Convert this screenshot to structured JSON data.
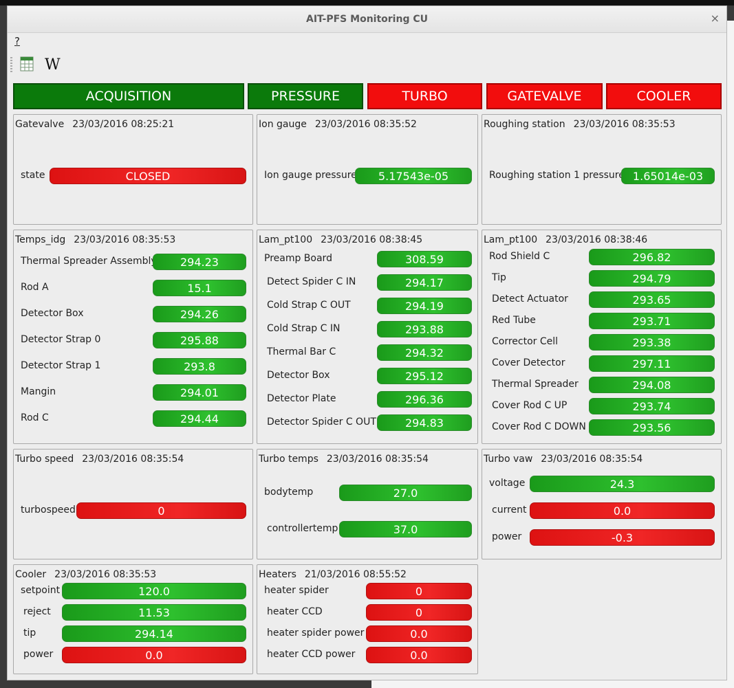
{
  "window": {
    "title": "AIT-PFS Monitoring CU",
    "close_glyph": "×"
  },
  "menu": {
    "help": "?"
  },
  "toolbar": {
    "sheet_icon": "spreadsheet-icon",
    "wiki_label": "W"
  },
  "status_buttons": [
    {
      "label": "ACQUISITION",
      "state": "green"
    },
    {
      "label": "PRESSURE",
      "state": "green"
    },
    {
      "label": "TURBO",
      "state": "red"
    },
    {
      "label": "GATEVALVE",
      "state": "red"
    },
    {
      "label": "COOLER",
      "state": "red"
    }
  ],
  "colors": {
    "ok": "#2ec02e",
    "alarm": "#f02626",
    "button_green": "#0b7a0b",
    "button_red": "#f20d0d"
  },
  "panels": {
    "gatevalve": {
      "name": "Gatevalve",
      "timestamp": "23/03/2016 08:25:21",
      "rows": [
        {
          "label": "state",
          "value": "CLOSED",
          "status": "r"
        }
      ]
    },
    "iongauge": {
      "name": "Ion gauge",
      "timestamp": "23/03/2016 08:35:52",
      "rows": [
        {
          "label": "Ion gauge pressure",
          "value": "5.17543e-05",
          "status": "g"
        }
      ]
    },
    "roughing": {
      "name": "Roughing station",
      "timestamp": "23/03/2016 08:35:53",
      "rows": [
        {
          "label": "Roughing station 1 pressure",
          "value": "1.65014e-03",
          "status": "g"
        }
      ]
    },
    "temps_idg": {
      "name": "Temps_idg",
      "timestamp": "23/03/2016 08:35:53",
      "rows": [
        {
          "label": "Thermal Spreader Assembly",
          "value": "294.23",
          "status": "g"
        },
        {
          "label": "Rod A",
          "value": "15.1",
          "status": "g"
        },
        {
          "label": "Detector Box",
          "value": "294.26",
          "status": "g"
        },
        {
          "label": "Detector Strap 0",
          "value": "295.88",
          "status": "g"
        },
        {
          "label": "Detector Strap 1",
          "value": "293.8",
          "status": "g"
        },
        {
          "label": "Mangin",
          "value": "294.01",
          "status": "g"
        },
        {
          "label": "Rod C",
          "value": "294.44",
          "status": "g"
        }
      ]
    },
    "lam_pt100_a": {
      "name": "Lam_pt100",
      "timestamp": "23/03/2016 08:38:45",
      "rows": [
        {
          "label": "Preamp Board",
          "value": "308.59",
          "status": "g"
        },
        {
          "label": "Detect Spider C IN",
          "value": "294.17",
          "status": "g"
        },
        {
          "label": "Cold Strap C OUT",
          "value": "294.19",
          "status": "g"
        },
        {
          "label": "Cold Strap C IN",
          "value": "293.88",
          "status": "g"
        },
        {
          "label": "Thermal Bar C",
          "value": "294.32",
          "status": "g"
        },
        {
          "label": "Detector Box",
          "value": "295.12",
          "status": "g"
        },
        {
          "label": "Detector Plate",
          "value": "296.36",
          "status": "g"
        },
        {
          "label": "Detector Spider C OUT",
          "value": "294.83",
          "status": "g"
        }
      ]
    },
    "lam_pt100_b": {
      "name": "Lam_pt100",
      "timestamp": "23/03/2016 08:38:46",
      "rows": [
        {
          "label": "Rod Shield C",
          "value": "296.82",
          "status": "g"
        },
        {
          "label": "Tip",
          "value": "294.79",
          "status": "g"
        },
        {
          "label": "Detect Actuator",
          "value": "293.65",
          "status": "g"
        },
        {
          "label": "Red Tube",
          "value": "293.71",
          "status": "g"
        },
        {
          "label": "Corrector Cell",
          "value": "293.38",
          "status": "g"
        },
        {
          "label": "Cover Detector",
          "value": "297.11",
          "status": "g"
        },
        {
          "label": "Thermal Spreader",
          "value": "294.08",
          "status": "g"
        },
        {
          "label": "Cover Rod C UP",
          "value": "293.74",
          "status": "g"
        },
        {
          "label": "Cover Rod C DOWN",
          "value": "293.56",
          "status": "g"
        }
      ]
    },
    "turbo_speed": {
      "name": "Turbo speed",
      "timestamp": "23/03/2016 08:35:54",
      "rows": [
        {
          "label": "turbospeed",
          "value": "0",
          "status": "r"
        }
      ]
    },
    "turbo_temps": {
      "name": "Turbo temps",
      "timestamp": "23/03/2016 08:35:54",
      "rows": [
        {
          "label": "bodytemp",
          "value": "27.0",
          "status": "g"
        },
        {
          "label": "controllertemp",
          "value": "37.0",
          "status": "g"
        }
      ]
    },
    "turbo_vaw": {
      "name": "Turbo vaw",
      "timestamp": "23/03/2016 08:35:54",
      "rows": [
        {
          "label": "voltage",
          "value": "24.3",
          "status": "g"
        },
        {
          "label": "current",
          "value": "0.0",
          "status": "r"
        },
        {
          "label": "power",
          "value": "-0.3",
          "status": "r"
        }
      ]
    },
    "cooler": {
      "name": "Cooler",
      "timestamp": "23/03/2016 08:35:53",
      "rows": [
        {
          "label": "setpoint",
          "value": "120.0",
          "status": "g"
        },
        {
          "label": "reject",
          "value": "11.53",
          "status": "g"
        },
        {
          "label": "tip",
          "value": "294.14",
          "status": "g"
        },
        {
          "label": "power",
          "value": "0.0",
          "status": "r"
        }
      ]
    },
    "heaters": {
      "name": "Heaters",
      "timestamp": "21/03/2016 08:55:52",
      "rows": [
        {
          "label": "heater spider",
          "value": "0",
          "status": "r"
        },
        {
          "label": "heater CCD",
          "value": "0",
          "status": "r"
        },
        {
          "label": "heater spider power",
          "value": "0.0",
          "status": "r"
        },
        {
          "label": "heater CCD power",
          "value": "0.0",
          "status": "r"
        }
      ]
    }
  }
}
